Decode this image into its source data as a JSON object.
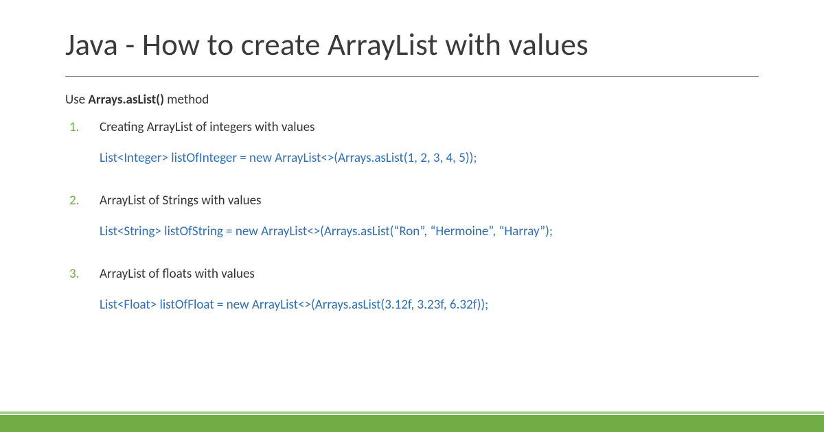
{
  "title": "Java - How to create ArrayList with values",
  "intro_prefix": "Use ",
  "intro_bold": "Arrays.asList()",
  "intro_suffix": " method",
  "items": [
    {
      "label": "Creating ArrayList of integers with values",
      "code": "List<Integer> listOfInteger = new ArrayList<>(Arrays.asList(1, 2, 3, 4, 5));"
    },
    {
      "label": "ArrayList of Strings with values",
      "code": "List<String> listOfString = new ArrayList<>(Arrays.asList(“Ron”, “Hermoine”, “Harray”);"
    },
    {
      "label": "ArrayList of floats with values",
      "code": "List<Float> listOfFloat = new ArrayList<>(Arrays.asList(3.12f, 3.23f, 6.32f));"
    }
  ]
}
